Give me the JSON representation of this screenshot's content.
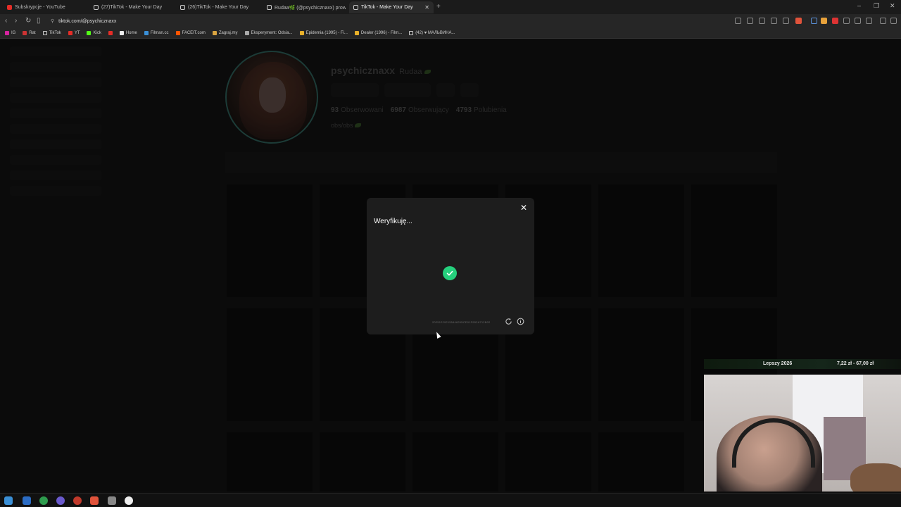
{
  "browser": {
    "tabs": [
      {
        "title": "Subskrypcje - YouTube",
        "active": false
      },
      {
        "title": "(27)TikTok - Make Your Day",
        "active": false
      },
      {
        "title": "(26)TikTok - Make Your Day",
        "active": false
      },
      {
        "title": "Rudaa🌿 (@psychicznaxx) prow...",
        "active": false
      },
      {
        "title": "TikTok - Make Your Day",
        "active": true
      }
    ],
    "url": "tiktok.com/@psychicznaxx",
    "bookmarks": [
      "IG",
      "Rat",
      "TikTok",
      "YT",
      "Kick",
      "Home",
      "Filman.cc",
      "FACEIT.com",
      "Zagraj.my",
      "Eksperyment: Odsia...",
      "Epidemia (1995) - Fi...",
      "Dealer (1996) - Film...",
      "(42) ♥ МАЛЬВИНА..."
    ],
    "colors": {
      "accent": "#25d07d"
    }
  },
  "profile": {
    "username": "psychicznaxx",
    "nickname": "Rudaa",
    "stats": [
      {
        "value": "93",
        "label": "Obserwowani"
      },
      {
        "value": "6987",
        "label": "Obserwujący"
      },
      {
        "value": "4793",
        "label": "Polubienia"
      }
    ],
    "bio": "obs/obs"
  },
  "modal": {
    "title": "Weryfikuję...",
    "code": "2025122921554462f0fCE01F952A712B02",
    "close_icon": "close-icon",
    "status_icon": "checkmark-icon"
  },
  "goal": {
    "name": "Lepszy 2026",
    "amount": "7,22 zł - 67,00 zł"
  }
}
